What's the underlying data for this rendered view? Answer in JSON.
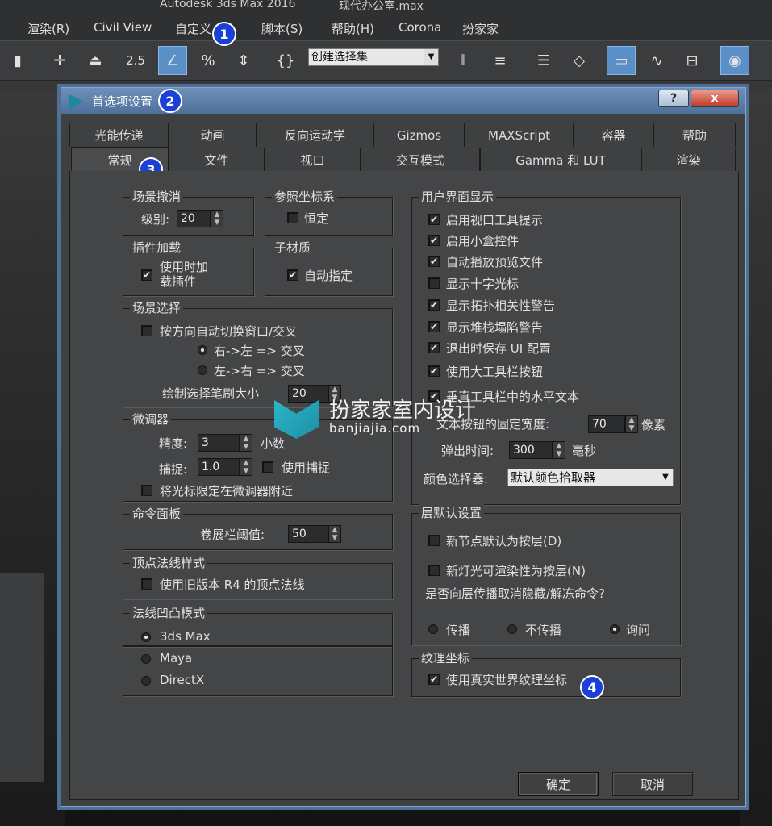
{
  "window": {
    "app_title": "Autodesk 3ds Max 2016",
    "file_name": "现代办公室.max"
  },
  "menu": {
    "items": [
      "渲染(R)",
      "Civil View",
      "自定义",
      "脚本(S)",
      "帮助(H)",
      "Corona",
      "扮家家"
    ]
  },
  "toolbar": {
    "selection_set_placeholder": "创建选择集",
    "snap_angle_label": "2.5",
    "percent_label": "%"
  },
  "badges": [
    "1",
    "2",
    "3",
    "4"
  ],
  "dialog": {
    "title": "首选项设置",
    "help_btn": "?",
    "close_btn": "x",
    "tabs_row1": [
      "光能传递",
      "动画",
      "反向运动学",
      "Gizmos",
      "MAXScript",
      "容器",
      "帮助"
    ],
    "tabs_row2": [
      "常规",
      "文件",
      "视口",
      "交互模式",
      "Gamma 和 LUT",
      "渲染"
    ],
    "ok": "确定",
    "cancel": "取消"
  },
  "scene_undo": {
    "title": "场景撤消",
    "level_label": "级别:",
    "level_value": "20"
  },
  "ref_coord": {
    "title": "参照坐标系",
    "constant": "恒定",
    "constant_checked": false
  },
  "plugin": {
    "title": "插件加载",
    "load_on_use_1": "使用时加",
    "load_on_use_2": "载插件",
    "checked": true
  },
  "sub_material": {
    "title": "子材质",
    "auto_assign": "自动指定",
    "checked": true
  },
  "scene_select": {
    "title": "场景选择",
    "auto_switch": "按方向自动切换窗口/交叉",
    "auto_switch_checked": false,
    "r2l": "右->左 => 交叉",
    "l2r": "左->右 => 交叉",
    "brush_label": "绘制选择笔刷大小",
    "brush_value": "20"
  },
  "spinner": {
    "title": "微调器",
    "precision_label": "精度:",
    "precision_value": "3",
    "precision_unit": "小数",
    "snap_label": "捕捉:",
    "snap_value": "1.0",
    "use_snap": "使用捕捉",
    "use_snap_checked": false,
    "wrap_cursor": "将光标限定在微调器附近",
    "wrap_cursor_checked": false
  },
  "command_panel": {
    "title": "命令面板",
    "rollout_label": "卷展栏阈值:",
    "rollout_value": "50"
  },
  "vertex_normal": {
    "title": "顶点法线样式",
    "legacy": "使用旧版本 R4 的顶点法线",
    "checked": false
  },
  "bump_mode": {
    "title": "法线凹凸模式",
    "options": [
      "3ds Max",
      "Maya",
      "DirectX"
    ],
    "selected": "3ds Max"
  },
  "ui_display": {
    "title": "用户界面显示",
    "items": [
      {
        "label": "启用视口工具提示",
        "checked": true
      },
      {
        "label": "启用小盒控件",
        "checked": true
      },
      {
        "label": "自动播放预览文件",
        "checked": true
      },
      {
        "label": "显示十字光标",
        "checked": false
      },
      {
        "label": "显示拓扑相关性警告",
        "checked": true
      },
      {
        "label": "显示堆栈塌陷警告",
        "checked": true
      },
      {
        "label": "退出时保存 UI 配置",
        "checked": true
      },
      {
        "label": "使用大工具栏按钮",
        "checked": true
      },
      {
        "label": "垂直工具栏中的水平文本",
        "checked": true
      }
    ],
    "fixed_width_label": "文本按钮的固定宽度:",
    "fixed_width_value": "70",
    "fixed_width_unit": "像素",
    "popup_label": "弹出时间:",
    "popup_value": "300",
    "popup_unit": "毫秒",
    "color_picker_label": "颜色选择器:",
    "color_picker_value": "默认颜色拾取器"
  },
  "layer_defaults": {
    "title": "层默认设置",
    "new_node": "新节点默认为按层(D)",
    "new_node_checked": false,
    "new_light": "新灯光可渲染性为按层(N)",
    "new_light_checked": false,
    "propagate_q": "是否向层传播取消隐藏/解冻命令?",
    "options": [
      "传播",
      "不传播",
      "询问"
    ],
    "selected": "询问"
  },
  "texture_coord": {
    "title": "纹理坐标",
    "real_world": "使用真实世界纹理坐标",
    "checked": true
  },
  "watermark": {
    "title": "扮家家室内设计",
    "url": "banjiajia.com"
  }
}
